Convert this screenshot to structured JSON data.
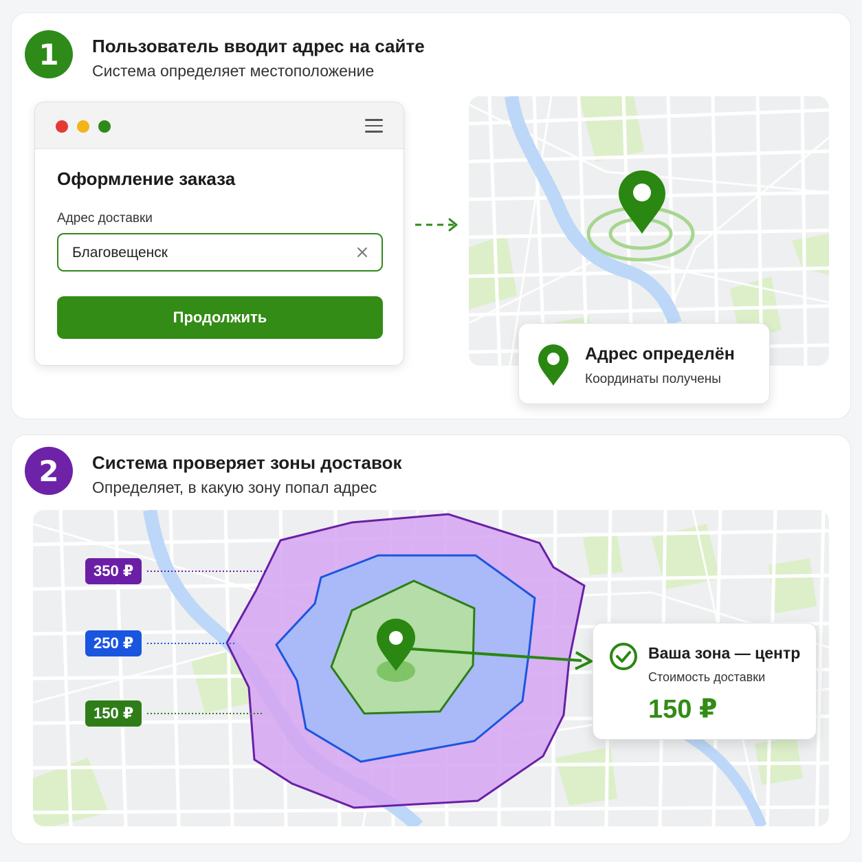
{
  "step1": {
    "number": "1",
    "title": "Пользователь вводит адрес на сайте",
    "subtitle": "Система определяет местоположение",
    "badge_color": "#2e8b1a"
  },
  "checkout": {
    "title": "Оформление заказа",
    "field_label": "Адрес доставки",
    "field_value": "Благовещенск",
    "button_label": "Продолжить",
    "window_dots": [
      "#e53935",
      "#f2b518",
      "#2e8b1a"
    ]
  },
  "detected": {
    "title": "Адрес определён",
    "subtitle": "Координаты получены",
    "icon": "map-pin-icon"
  },
  "step2": {
    "number": "2",
    "title": "Система проверяет зоны доставок",
    "subtitle": "Определяет, в какую зону попал адрес",
    "badge_color": "#6d22a8"
  },
  "zones": [
    {
      "price": "350 ₽",
      "color": "#6a1fa6"
    },
    {
      "price": "250 ₽",
      "color": "#1a55e0"
    },
    {
      "price": "150 ₽",
      "color": "#2e7d18"
    }
  ],
  "result": {
    "title": "Ваша зона — центр",
    "subtitle": "Стоимость доставки",
    "price": "150 ₽",
    "icon": "check-circle-icon"
  },
  "colors": {
    "accent_green": "#338c15",
    "purple": "#6d22a8",
    "blue": "#1a55e0",
    "river": "#bcd7f8",
    "park": "#dcefc9",
    "map_bg": "#eeeff0"
  }
}
